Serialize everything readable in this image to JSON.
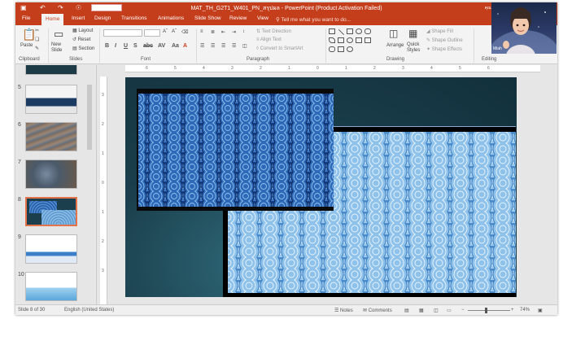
{
  "window": {
    "title": "MAT_TH_G2T1_W401_PN_สรุปผล - PowerPoint (Product Activation Failed)",
    "user": "คุณค"
  },
  "qat": {
    "save": "▣",
    "undo": "↶",
    "redo": "↷",
    "start": "☉"
  },
  "tabs": [
    {
      "label": "File"
    },
    {
      "label": "Home"
    },
    {
      "label": "Insert"
    },
    {
      "label": "Design"
    },
    {
      "label": "Transitions"
    },
    {
      "label": "Animations"
    },
    {
      "label": "Slide Show"
    },
    {
      "label": "Review"
    },
    {
      "label": "View"
    }
  ],
  "tellme": "Tell me what you want to do...",
  "ribbon": {
    "clipboard": {
      "label": "Clipboard",
      "paste": "Paste"
    },
    "slides": {
      "label": "Slides",
      "new_slide": "New Slide",
      "layout": "Layout",
      "reset": "Reset",
      "section": "Section"
    },
    "font": {
      "label": "Font"
    },
    "paragraph": {
      "label": "Paragraph",
      "text_direction": "Text Direction",
      "align_text": "Align Text",
      "convert_smartart": "Convert to SmartArt"
    },
    "drawing": {
      "label": "Drawing",
      "arrange": "Arrange",
      "quick_styles": "Quick Styles",
      "shape_fill": "Shape Fill",
      "shape_outline": "Shape Outline",
      "shape_effects": "Shape Effects"
    },
    "editing": {
      "label": "Editing"
    }
  },
  "thumbnails": [
    {
      "num": "5"
    },
    {
      "num": "6"
    },
    {
      "num": "7"
    },
    {
      "num": "8"
    },
    {
      "num": "9"
    },
    {
      "num": "10"
    }
  ],
  "ruler_h": [
    "6",
    "5",
    "4",
    "3",
    "2",
    "1",
    "0",
    "1",
    "2",
    "3",
    "4",
    "5",
    "6"
  ],
  "ruler_v": [
    "3",
    "2",
    "1",
    "0",
    "1",
    "2",
    "3"
  ],
  "status": {
    "slide": "Slide 8 of 30",
    "language": "English (United States)",
    "notes": "Notes",
    "comments": "Comments",
    "zoom": "74%"
  },
  "webcam": {
    "name": "Miah"
  },
  "colors": {
    "accent": "#c43e1c",
    "ribbon": "#f3f3f3",
    "slide_bg": "#1b3f4c",
    "wave_dark": "#1a4fa0",
    "wave_light": "#7fb7e2",
    "selection": "#e2734a"
  }
}
